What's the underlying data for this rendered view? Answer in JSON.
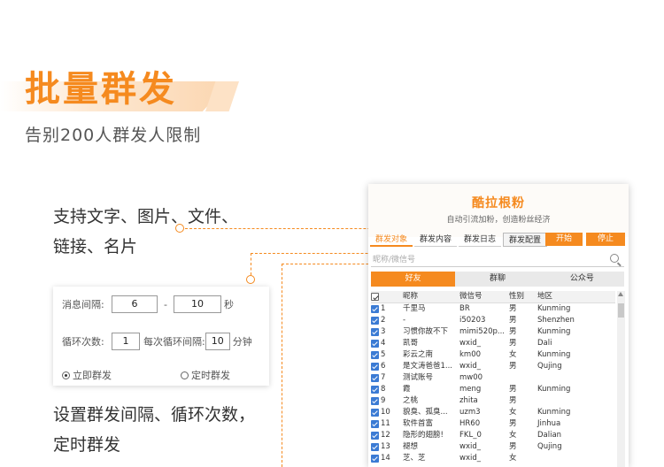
{
  "header": {
    "title": "批量群发",
    "subtitle": "告别200人群发人限制"
  },
  "features": {
    "content_types": [
      "支持文字、图片、文件、",
      "链接、名片"
    ],
    "interval_desc": [
      "设置群发间隔、循环次数，",
      "定时群发"
    ]
  },
  "settings": {
    "interval_label": "消息间隔:",
    "interval_min": "6",
    "interval_sep": "-",
    "interval_max": "10",
    "interval_unit": "秒",
    "loop_label": "循环次数:",
    "loop_count": "1",
    "loop_interval_label": "每次循环间隔:",
    "loop_interval": "10",
    "loop_interval_unit": "分钟",
    "immediate": "立即群发",
    "scheduled": "定时群发"
  },
  "app": {
    "title": "酷拉根粉",
    "slogan": "自动引流加粉，创造粉丝经济",
    "tabs": [
      "群发对象",
      "群发内容",
      "群发日志",
      "群发配置"
    ],
    "start": "开始",
    "stop": "停止",
    "search_placeholder": "昵称/微信号",
    "subtabs": [
      "好友",
      "群聊",
      "公众号"
    ],
    "columns": [
      "昵称",
      "微信号",
      "性别",
      "地区"
    ],
    "rows": [
      {
        "idx": "1",
        "nick": "千里马",
        "wxid": "BR",
        "sex": "男",
        "region": "Kunming"
      },
      {
        "idx": "2",
        "nick": "-",
        "wxid": "i50203",
        "sex": "男",
        "region": "Shenzhen"
      },
      {
        "idx": "3",
        "nick": "习惯你故不下",
        "wxid": "mimi520p...",
        "sex": "男",
        "region": "Kunming"
      },
      {
        "idx": "4",
        "nick": "凯哥",
        "wxid": "wxid_",
        "sex": "男",
        "region": "Dali"
      },
      {
        "idx": "5",
        "nick": "彩云之南",
        "wxid": "km00",
        "sex": "女",
        "region": "Kunming"
      },
      {
        "idx": "6",
        "nick": "是文涛爸爸1...",
        "wxid": "wxid_",
        "sex": "男",
        "region": "Qujing"
      },
      {
        "idx": "7",
        "nick": "测试账号",
        "wxid": "mw00",
        "sex": "",
        "region": ""
      },
      {
        "idx": "8",
        "nick": "霞",
        "wxid": "meng",
        "sex": "男",
        "region": "Kunming"
      },
      {
        "idx": "9",
        "nick": "之桃",
        "wxid": "zhita",
        "sex": "男",
        "region": ""
      },
      {
        "idx": "10",
        "nick": "貌臭、孤臭...",
        "wxid": "uzm3",
        "sex": "女",
        "region": "Kunming"
      },
      {
        "idx": "11",
        "nick": "软件首富",
        "wxid": "HR60",
        "sex": "男",
        "region": "Jinhua"
      },
      {
        "idx": "12",
        "nick": "隐形的翅膀!",
        "wxid": "FKL_0",
        "sex": "女",
        "region": "Dalian"
      },
      {
        "idx": "13",
        "nick": "褪想",
        "wxid": "wxid_",
        "sex": "男",
        "region": "Qujing"
      },
      {
        "idx": "14",
        "nick": "芝、芝",
        "wxid": "wxid_",
        "sex": "女",
        "region": ""
      }
    ]
  },
  "colors": {
    "accent": "#f58a1f",
    "checkbox": "#3b7bd4"
  }
}
